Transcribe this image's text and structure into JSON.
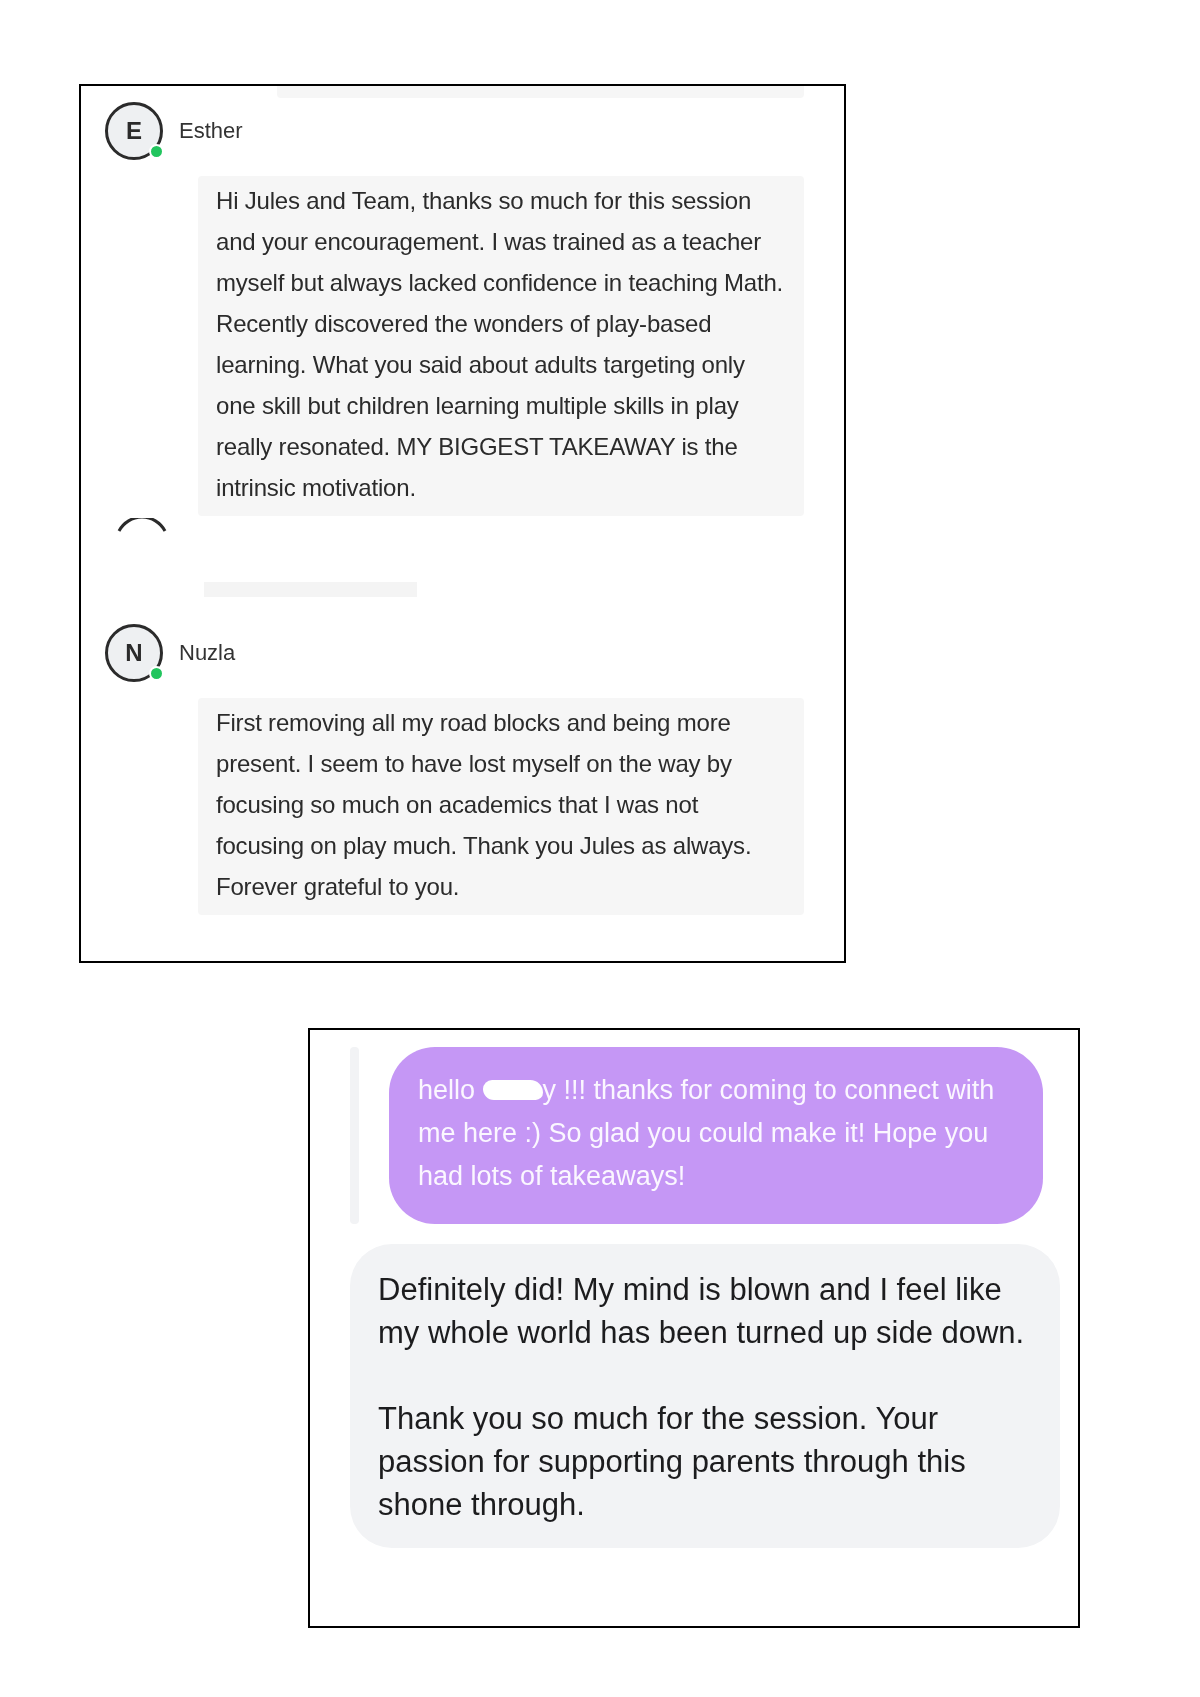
{
  "top_chat": {
    "messages": [
      {
        "kind": "message",
        "sender": "Esther",
        "initial": "E",
        "online": true,
        "text": "Hi Jules and Team, thanks so much for this session and your encouragement. I was trained as a teacher myself but always lacked confidence in teaching Math. Recently discovered the wonders of play-based learning. What you said about adults targeting only one skill but children learning multiple skills in play really resonated. MY BIGGEST TAKEAWAY is the intrinsic motivation."
      },
      {
        "kind": "message",
        "sender": "Nuzla",
        "initial": "N",
        "online": true,
        "text": "First removing all my road blocks and being more present. I seem to have lost myself on the way by focusing so much on academics that I was not focusing on play much. Thank you Jules as always. Forever grateful to you."
      }
    ]
  },
  "bottom_chat": {
    "messages": [
      {
        "kind": "sent",
        "text_before": "hello",
        "redacted": true,
        "text_after": "y !!! thanks for coming to connect with me here :) So glad you could make it! Hope you had lots of takeaways!"
      },
      {
        "kind": "received",
        "paragraphs": [
          "Definitely did! My mind is blown and I feel like my whole world has been turned up side down.",
          "Thank you so much for the session. Your passion for supporting parents through this shone through."
        ]
      }
    ]
  }
}
